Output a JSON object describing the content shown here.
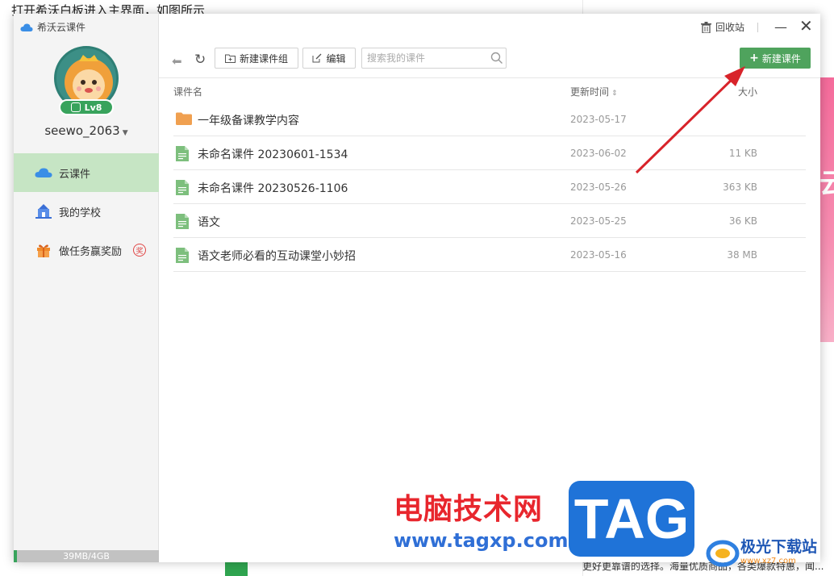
{
  "background": {
    "caption": "打开希沃白板进入主界面，如图所示",
    "right_strip_glyph": "云",
    "bottom_text": "更好更靠谱的选择。海量优质商品，各类爆款特惠，闻..."
  },
  "app": {
    "title": "希沃云课件",
    "user": {
      "name": "seewo_2063",
      "level": "Lv8"
    },
    "nav": [
      {
        "label": "云课件",
        "icon": "cloud-icon",
        "active": true
      },
      {
        "label": "我的学校",
        "icon": "school-icon",
        "active": false
      },
      {
        "label": "做任务赢奖励",
        "icon": "gift-icon",
        "active": false,
        "badge": "奖"
      }
    ],
    "storage": "39MB/4GB",
    "window_controls": {
      "recycle_label": "回收站",
      "minimize": "—",
      "close": "✕"
    },
    "toolbar": {
      "new_group_label": "新建课件组",
      "edit_label": "编辑",
      "search_placeholder": "搜索我的课件",
      "new_courseware_label": "新建课件"
    },
    "table": {
      "columns": {
        "name": "课件名",
        "updated": "更新时间",
        "size": "大小"
      },
      "rows": [
        {
          "type": "folder",
          "name": "一年级备课教学内容",
          "updated": "2023-05-17",
          "size": ""
        },
        {
          "type": "file",
          "name": "未命名课件 20230601-1534",
          "updated": "2023-06-02",
          "size": "11 KB"
        },
        {
          "type": "file",
          "name": "未命名课件 20230526-1106",
          "updated": "2023-05-26",
          "size": "363 KB"
        },
        {
          "type": "file",
          "name": "语文",
          "updated": "2023-05-25",
          "size": "36 KB"
        },
        {
          "type": "file",
          "name": "语文老师必看的互动课堂小妙招",
          "updated": "2023-05-16",
          "size": "38 MB"
        }
      ]
    }
  },
  "watermarks": {
    "site_cn": "电脑技术网",
    "site_url": "www.tagxp.com",
    "tag": "TAG",
    "logo_name": "极光下载站",
    "logo_url": "www.xz7.com"
  },
  "colors": {
    "accent_green": "#4fa35d",
    "active_nav_bg": "#c6e5c4",
    "arrow_red": "#d8232a",
    "watermark_red": "#e8262d",
    "watermark_blue": "#1f73d8"
  }
}
